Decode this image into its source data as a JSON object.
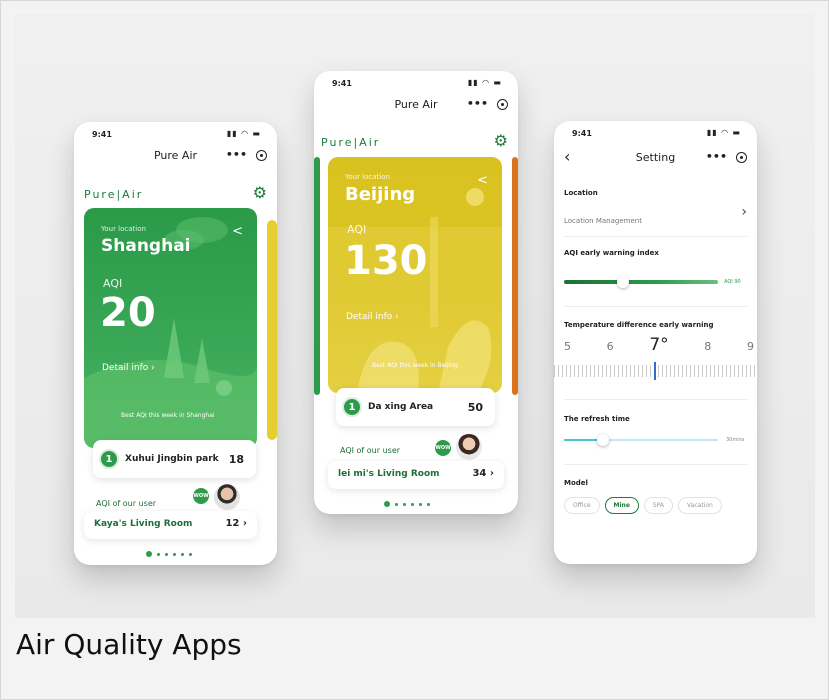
{
  "caption": "Air Quality Apps",
  "colors": {
    "green": "#2e9a4c",
    "yellow": "#d9c21f",
    "orange": "#d9731f",
    "teal": "#45c4c9",
    "brand_green": "#1f7a3a"
  },
  "phone_left": {
    "status_time": "9:41",
    "status_icons": "signal-wifi-battery",
    "nav_title": "Pure Air",
    "brand": "Pure|Air",
    "card": {
      "location_label": "Your location",
      "city": "Shanghai",
      "aqi_label": "AQI",
      "aqi_value": "20",
      "detail_link": "Detail info",
      "best_text": "Best AQI this week in Shanghai"
    },
    "ranking": {
      "rank": "1",
      "name": "Xuhui Jingbin park",
      "value": "18"
    },
    "user": {
      "label": "AQI of our user",
      "badge": "WOW",
      "room_name": "Kaya's Living Room",
      "room_value": "12"
    }
  },
  "phone_center": {
    "status_time": "9:41",
    "nav_title": "Pure Air",
    "brand": "Pure|Air",
    "card": {
      "location_label": "Your location",
      "city": "Beijing",
      "aqi_label": "AQI",
      "aqi_value": "130",
      "detail_link": "Detail info",
      "best_text": "Best AQI this week in Beijing"
    },
    "ranking": {
      "rank": "1",
      "name": "Da xing Area",
      "value": "50"
    },
    "user": {
      "label": "AQI of our user",
      "badge": "WOW",
      "room_name": "lei mi's Living Room",
      "room_value": "34"
    }
  },
  "phone_right": {
    "status_time": "9:41",
    "nav_title": "Setting",
    "location": {
      "title": "Location",
      "item": "Location Management"
    },
    "aqi_warning": {
      "title": "AQI early warning index",
      "value_label": "AQI 90",
      "level": 0.38
    },
    "temperature": {
      "title": "Temperature difference early warning",
      "numbers": [
        "5",
        "6",
        "7°",
        "8",
        "9"
      ],
      "current": "7°"
    },
    "refresh": {
      "title": "The refresh time",
      "value_label": "30mins",
      "level": 0.25
    },
    "model": {
      "title": "Model",
      "options": [
        "Office",
        "Mine",
        "SPA",
        "Vacation"
      ],
      "selected": "Mine"
    }
  }
}
